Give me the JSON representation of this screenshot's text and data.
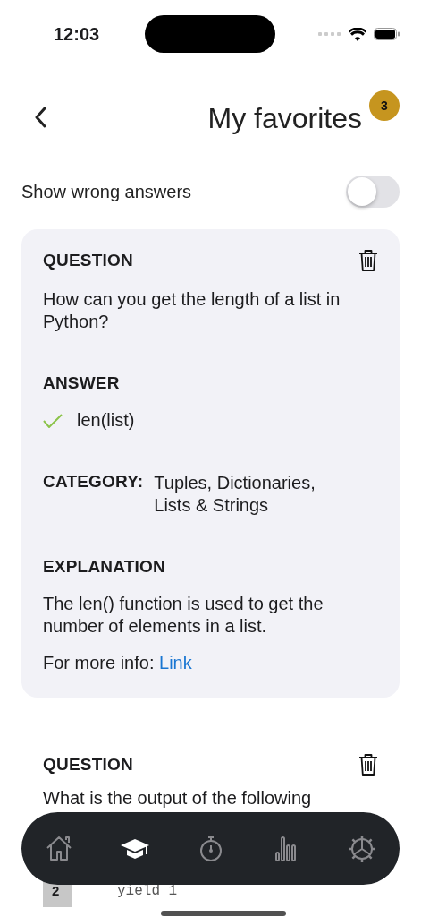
{
  "status_bar": {
    "time": "12:03"
  },
  "header": {
    "title": "My favorites",
    "badge": "3"
  },
  "filter": {
    "label": "Show wrong answers",
    "on": false
  },
  "cards": [
    {
      "kind": "shaded",
      "question_label": "QUESTION",
      "question": "How can you get the length of a list in Python?",
      "answer_label": "ANSWER",
      "answers": [
        {
          "text": "len(list)",
          "correct": true
        }
      ],
      "category_label": "CATEGORY:",
      "category": "Tuples, Dictionaries, Lists & Strings",
      "explanation_label": "EXPLANATION",
      "explanation": "The len() function is used to get the number of elements in a list.",
      "info_prefix": "For more info:",
      "link": "Link"
    },
    {
      "kind": "plain",
      "question_label": "QUESTION",
      "question": "What is the output of the following",
      "code_lines": [
        {
          "number": "2",
          "text": "yield 1"
        }
      ]
    }
  ],
  "tabs": [
    {
      "selected": false
    },
    {
      "selected": true
    },
    {
      "selected": false
    },
    {
      "selected": false
    },
    {
      "selected": false
    }
  ]
}
